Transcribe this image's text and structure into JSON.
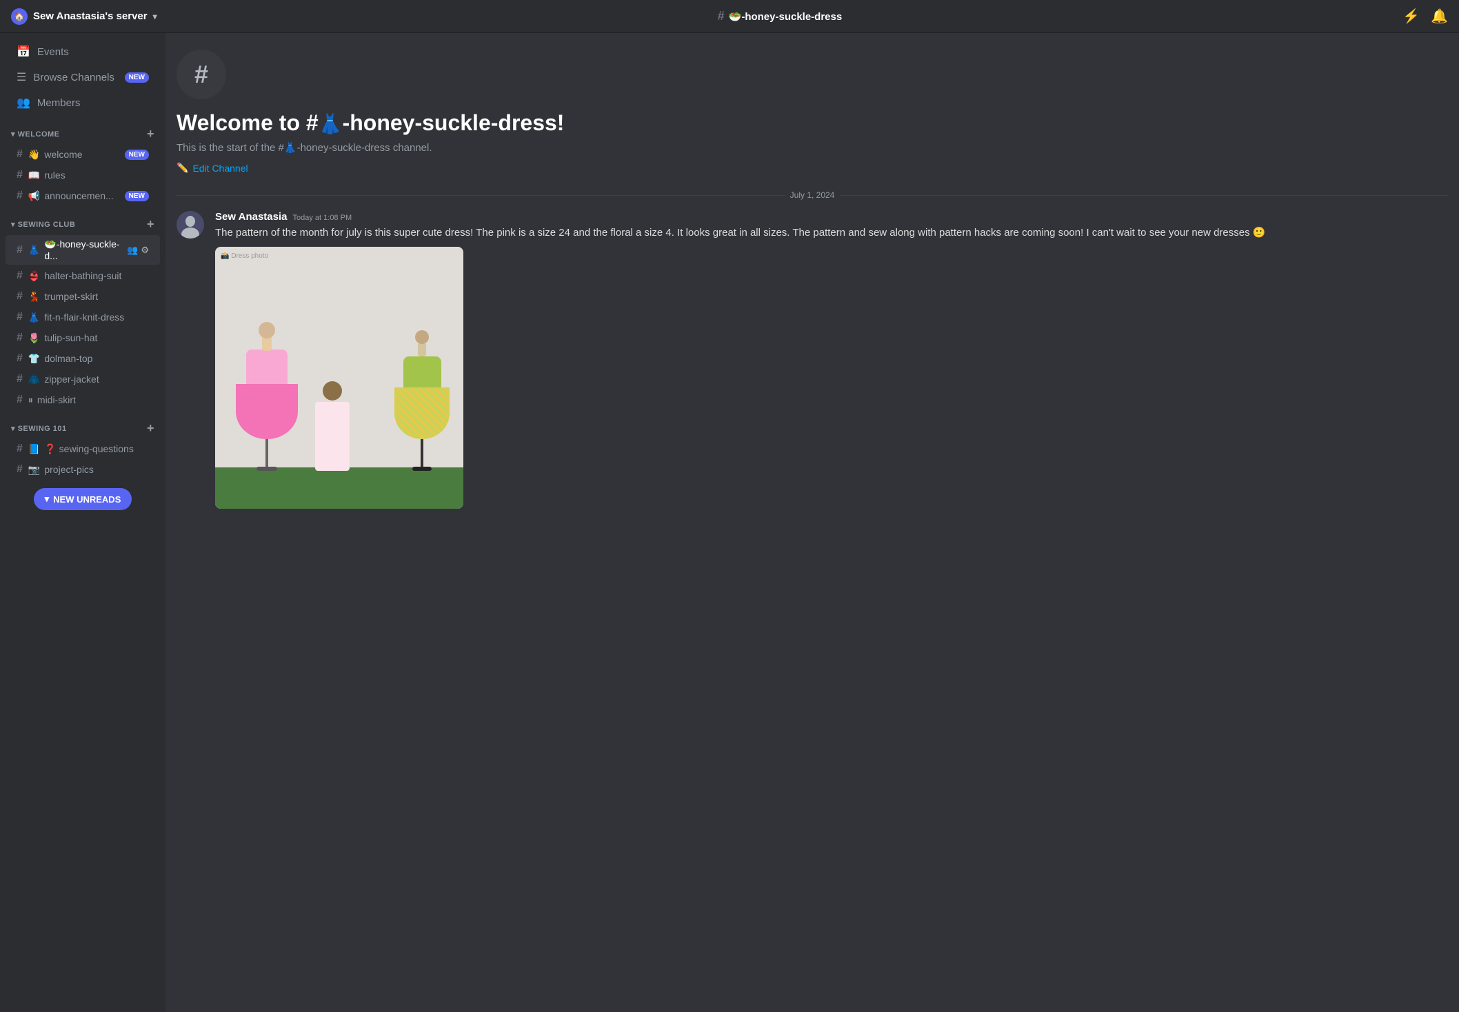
{
  "topBar": {
    "serverName": "Sew Anastasia's server",
    "channelName": "🥗-honey-suckle-dress",
    "channelHash": "#"
  },
  "sidebar": {
    "navItems": [
      {
        "id": "events",
        "icon": "📅",
        "label": "Events",
        "badge": null
      },
      {
        "id": "browse-channels",
        "icon": "☰",
        "label": "Browse Channels",
        "badge": "NEW"
      },
      {
        "id": "members",
        "icon": "👥",
        "label": "Members",
        "badge": null
      }
    ],
    "sections": [
      {
        "id": "welcome",
        "label": "WELCOME",
        "channels": [
          {
            "id": "welcome-ch",
            "emoji": "👋",
            "name": "welcome",
            "badge": "NEW",
            "active": false
          },
          {
            "id": "rules",
            "emoji": "📖",
            "name": "rules",
            "badge": null,
            "active": false
          },
          {
            "id": "announcements",
            "emoji": "📢",
            "name": "announcemen...",
            "badge": "NEW",
            "active": false
          }
        ]
      },
      {
        "id": "sewing-club",
        "label": "SEWING CLUB",
        "channels": [
          {
            "id": "honey-suckle",
            "emoji": "👗",
            "name": "🥗-honey-suckle-d...",
            "badge": null,
            "active": true,
            "hasIcons": true
          },
          {
            "id": "halter",
            "emoji": "👙",
            "name": "halter-bathing-suit",
            "badge": null,
            "active": false
          },
          {
            "id": "trumpet",
            "emoji": "💃",
            "name": "trumpet-skirt",
            "badge": null,
            "active": false
          },
          {
            "id": "fit-n-flair",
            "emoji": "👗",
            "name": "fit-n-flair-knit-dress",
            "badge": null,
            "active": false
          },
          {
            "id": "tulip",
            "emoji": "🌷",
            "name": "tulip-sun-hat",
            "badge": null,
            "active": false
          },
          {
            "id": "dolman",
            "emoji": "👕",
            "name": "dolman-top",
            "badge": null,
            "active": false
          },
          {
            "id": "zipper",
            "emoji": "🧥",
            "name": "zipper-jacket",
            "badge": null,
            "active": false
          },
          {
            "id": "midi",
            "emoji": "⏸",
            "name": "midi-skirt",
            "badge": null,
            "active": false
          }
        ]
      },
      {
        "id": "sewing-101",
        "label": "SEWING 101",
        "channels": [
          {
            "id": "sewing-questions",
            "emoji": "📘",
            "name": "❓ sewing-questions",
            "badge": null,
            "active": false
          },
          {
            "id": "project-pics",
            "emoji": "📷",
            "name": "project-pics",
            "badge": null,
            "active": false
          }
        ]
      }
    ]
  },
  "chat": {
    "channelName": "🥗-honey-suckle-dress",
    "welcomeTitle": "Welcome to #👗-honey-suckle-dress!",
    "welcomeDesc": "This is the start of the #👗-honey-suckle-dress channel.",
    "editChannelLabel": "Edit Channel",
    "dateDivider": "July 1, 2024",
    "messages": [
      {
        "id": "msg1",
        "author": "Sew Anastasia",
        "time": "Today at 1:08 PM",
        "text": "The pattern of the month for july is this super cute dress! The pink is a size 24 and the floral a size 4. It looks great in all sizes. The pattern and sew along with pattern hacks are coming soon! I can't wait to see your new dresses 🙂",
        "hasImage": true
      }
    ],
    "newUnreadsLabel": "NEW UNREADS"
  },
  "icons": {
    "hash": "#",
    "chevronDown": "▾",
    "pencil": "✏️",
    "threads": "≡",
    "bell": "🔔",
    "plus": "+",
    "settings": "⚙",
    "members2": "👥"
  }
}
